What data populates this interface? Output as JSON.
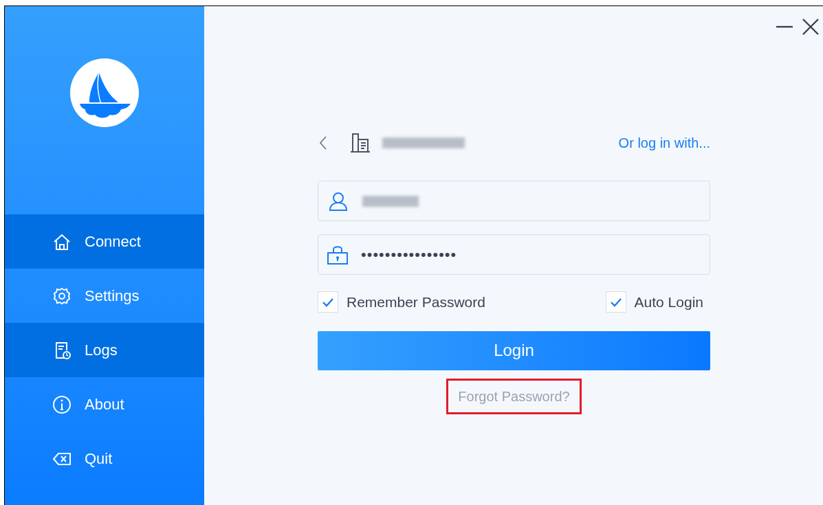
{
  "window": {
    "controls": [
      {
        "kind": "minimize"
      },
      {
        "kind": "close"
      }
    ]
  },
  "sidebar": {
    "items": [
      {
        "label": "Connect",
        "highlighted": true
      },
      {
        "label": "Settings",
        "highlighted": false
      },
      {
        "label": "Logs",
        "highlighted": true
      },
      {
        "label": "About",
        "highlighted": false
      },
      {
        "label": "Quit",
        "highlighted": false
      }
    ]
  },
  "login": {
    "alt_login_link": "Or log in with...",
    "password": {
      "value": "••••••••••••••••"
    },
    "options": [
      {
        "label": "Remember Password",
        "checked": true
      },
      {
        "label": "Auto Login",
        "checked": true
      }
    ],
    "submit": "Login",
    "forgot_link": {
      "label": "Forgot Password?",
      "highlighted": true
    }
  }
}
